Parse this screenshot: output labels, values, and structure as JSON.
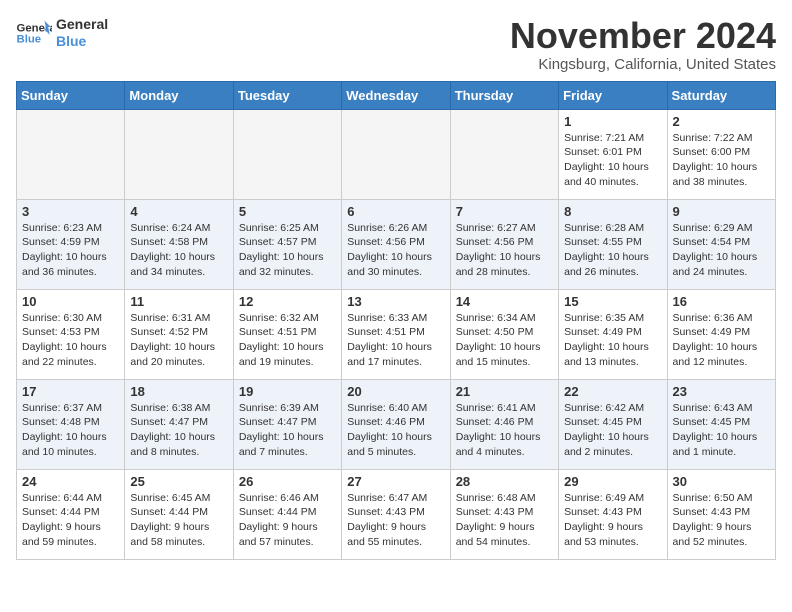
{
  "header": {
    "logo_line1": "General",
    "logo_line2": "Blue",
    "month": "November 2024",
    "location": "Kingsburg, California, United States"
  },
  "weekdays": [
    "Sunday",
    "Monday",
    "Tuesday",
    "Wednesday",
    "Thursday",
    "Friday",
    "Saturday"
  ],
  "rows": [
    [
      {
        "day": "",
        "info": ""
      },
      {
        "day": "",
        "info": ""
      },
      {
        "day": "",
        "info": ""
      },
      {
        "day": "",
        "info": ""
      },
      {
        "day": "",
        "info": ""
      },
      {
        "day": "1",
        "info": "Sunrise: 7:21 AM\nSunset: 6:01 PM\nDaylight: 10 hours and 40 minutes."
      },
      {
        "day": "2",
        "info": "Sunrise: 7:22 AM\nSunset: 6:00 PM\nDaylight: 10 hours and 38 minutes."
      }
    ],
    [
      {
        "day": "3",
        "info": "Sunrise: 6:23 AM\nSunset: 4:59 PM\nDaylight: 10 hours and 36 minutes."
      },
      {
        "day": "4",
        "info": "Sunrise: 6:24 AM\nSunset: 4:58 PM\nDaylight: 10 hours and 34 minutes."
      },
      {
        "day": "5",
        "info": "Sunrise: 6:25 AM\nSunset: 4:57 PM\nDaylight: 10 hours and 32 minutes."
      },
      {
        "day": "6",
        "info": "Sunrise: 6:26 AM\nSunset: 4:56 PM\nDaylight: 10 hours and 30 minutes."
      },
      {
        "day": "7",
        "info": "Sunrise: 6:27 AM\nSunset: 4:56 PM\nDaylight: 10 hours and 28 minutes."
      },
      {
        "day": "8",
        "info": "Sunrise: 6:28 AM\nSunset: 4:55 PM\nDaylight: 10 hours and 26 minutes."
      },
      {
        "day": "9",
        "info": "Sunrise: 6:29 AM\nSunset: 4:54 PM\nDaylight: 10 hours and 24 minutes."
      }
    ],
    [
      {
        "day": "10",
        "info": "Sunrise: 6:30 AM\nSunset: 4:53 PM\nDaylight: 10 hours and 22 minutes."
      },
      {
        "day": "11",
        "info": "Sunrise: 6:31 AM\nSunset: 4:52 PM\nDaylight: 10 hours and 20 minutes."
      },
      {
        "day": "12",
        "info": "Sunrise: 6:32 AM\nSunset: 4:51 PM\nDaylight: 10 hours and 19 minutes."
      },
      {
        "day": "13",
        "info": "Sunrise: 6:33 AM\nSunset: 4:51 PM\nDaylight: 10 hours and 17 minutes."
      },
      {
        "day": "14",
        "info": "Sunrise: 6:34 AM\nSunset: 4:50 PM\nDaylight: 10 hours and 15 minutes."
      },
      {
        "day": "15",
        "info": "Sunrise: 6:35 AM\nSunset: 4:49 PM\nDaylight: 10 hours and 13 minutes."
      },
      {
        "day": "16",
        "info": "Sunrise: 6:36 AM\nSunset: 4:49 PM\nDaylight: 10 hours and 12 minutes."
      }
    ],
    [
      {
        "day": "17",
        "info": "Sunrise: 6:37 AM\nSunset: 4:48 PM\nDaylight: 10 hours and 10 minutes."
      },
      {
        "day": "18",
        "info": "Sunrise: 6:38 AM\nSunset: 4:47 PM\nDaylight: 10 hours and 8 minutes."
      },
      {
        "day": "19",
        "info": "Sunrise: 6:39 AM\nSunset: 4:47 PM\nDaylight: 10 hours and 7 minutes."
      },
      {
        "day": "20",
        "info": "Sunrise: 6:40 AM\nSunset: 4:46 PM\nDaylight: 10 hours and 5 minutes."
      },
      {
        "day": "21",
        "info": "Sunrise: 6:41 AM\nSunset: 4:46 PM\nDaylight: 10 hours and 4 minutes."
      },
      {
        "day": "22",
        "info": "Sunrise: 6:42 AM\nSunset: 4:45 PM\nDaylight: 10 hours and 2 minutes."
      },
      {
        "day": "23",
        "info": "Sunrise: 6:43 AM\nSunset: 4:45 PM\nDaylight: 10 hours and 1 minute."
      }
    ],
    [
      {
        "day": "24",
        "info": "Sunrise: 6:44 AM\nSunset: 4:44 PM\nDaylight: 9 hours and 59 minutes."
      },
      {
        "day": "25",
        "info": "Sunrise: 6:45 AM\nSunset: 4:44 PM\nDaylight: 9 hours and 58 minutes."
      },
      {
        "day": "26",
        "info": "Sunrise: 6:46 AM\nSunset: 4:44 PM\nDaylight: 9 hours and 57 minutes."
      },
      {
        "day": "27",
        "info": "Sunrise: 6:47 AM\nSunset: 4:43 PM\nDaylight: 9 hours and 55 minutes."
      },
      {
        "day": "28",
        "info": "Sunrise: 6:48 AM\nSunset: 4:43 PM\nDaylight: 9 hours and 54 minutes."
      },
      {
        "day": "29",
        "info": "Sunrise: 6:49 AM\nSunset: 4:43 PM\nDaylight: 9 hours and 53 minutes."
      },
      {
        "day": "30",
        "info": "Sunrise: 6:50 AM\nSunset: 4:43 PM\nDaylight: 9 hours and 52 minutes."
      }
    ]
  ]
}
